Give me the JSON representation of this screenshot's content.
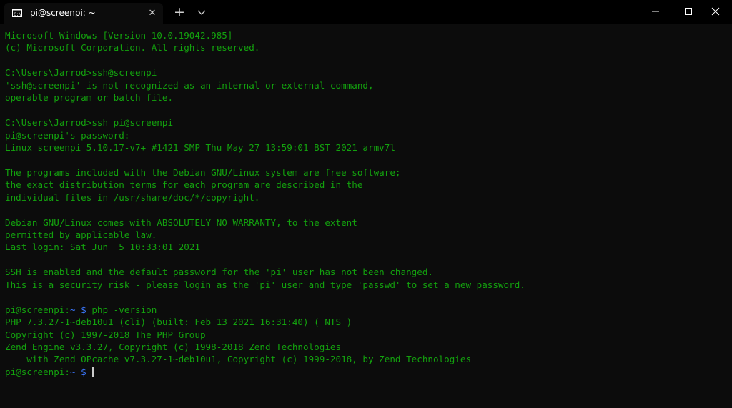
{
  "window": {
    "tab_title": "pi@screenpi: ~",
    "tab_close_glyph": "✕",
    "new_tab_glyph": "+",
    "icons": {
      "tab_icon": "terminal-icon",
      "dropdown": "chevron-down-icon",
      "minimize": "minimize-icon",
      "maximize": "maximize-icon",
      "close": "close-icon"
    }
  },
  "terminal": {
    "lines": [
      "Microsoft Windows [Version 10.0.19042.985]",
      "(c) Microsoft Corporation. All rights reserved.",
      "",
      "C:\\Users\\Jarrod>ssh@screenpi",
      "'ssh@screenpi' is not recognized as an internal or external command,",
      "operable program or batch file.",
      "",
      "C:\\Users\\Jarrod>ssh pi@screenpi",
      "pi@screenpi's password:",
      "Linux screenpi 5.10.17-v7+ #1421 SMP Thu May 27 13:59:01 BST 2021 armv7l",
      "",
      "The programs included with the Debian GNU/Linux system are free software;",
      "the exact distribution terms for each program are described in the",
      "individual files in /usr/share/doc/*/copyright.",
      "",
      "Debian GNU/Linux comes with ABSOLUTELY NO WARRANTY, to the extent",
      "permitted by applicable law.",
      "Last login: Sat Jun  5 10:33:01 2021",
      "",
      "SSH is enabled and the default password for the 'pi' user has not been changed.",
      "This is a security risk - please login as the 'pi' user and type 'passwd' to set a new password.",
      ""
    ],
    "prompt1": {
      "host": "pi@screenpi:",
      "path": "~",
      "dollar": " $",
      "command": " php -version"
    },
    "output_lines": [
      "PHP 7.3.27-1~deb10u1 (cli) (built: Feb 13 2021 16:31:40) ( NTS )",
      "Copyright (c) 1997-2018 The PHP Group",
      "Zend Engine v3.3.27, Copyright (c) 1998-2018 Zend Technologies",
      "    with Zend OPcache v7.3.27-1~deb10u1, Copyright (c) 1999-2018, by Zend Technologies"
    ],
    "prompt2": {
      "host": "pi@screenpi:",
      "path": "~",
      "dollar": " $",
      "command": " "
    },
    "colors": {
      "background": "#0c0c0c",
      "text": "#13a10e",
      "prompt_path": "#3b78ff",
      "titlebar": "#000000"
    }
  }
}
